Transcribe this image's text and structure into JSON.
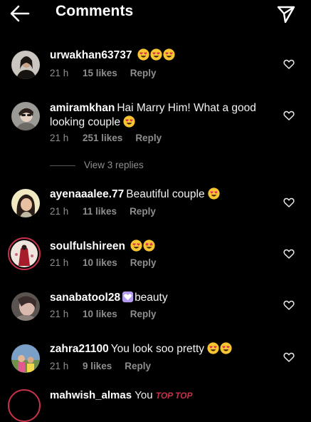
{
  "header": {
    "title": "Comments",
    "back_icon": "arrow-left-icon",
    "share_icon": "paper-plane-icon"
  },
  "comments": [
    {
      "username": "urwakhan63737",
      "text": "",
      "emojis": [
        "heart-eyes",
        "heart-eyes",
        "heart-eyes"
      ],
      "time": "21 h",
      "likes": "15 likes",
      "reply": "Reply"
    },
    {
      "username": "amiramkhan",
      "text": "Hai Marry Him! What a good looking couple",
      "emojis": [
        "heart-eyes"
      ],
      "time": "21 h",
      "likes": "251 likes",
      "reply": "Reply",
      "view_replies": "View 3 replies"
    },
    {
      "username": "ayenaaalee.77",
      "text": "Beautiful couple",
      "emojis": [
        "heart-eyes"
      ],
      "time": "21 h",
      "likes": "11 likes",
      "reply": "Reply"
    },
    {
      "username": "soulfulshireen",
      "text": "",
      "emojis": [
        "heart-eyes",
        "star-struck"
      ],
      "time": "21 h",
      "likes": "10 likes",
      "reply": "Reply"
    },
    {
      "username": "sanabatool28",
      "text": "beauty",
      "emojis": [
        "heart-box"
      ],
      "time": "21 h",
      "likes": "10 likes",
      "reply": "Reply"
    },
    {
      "username": "zahra21100",
      "text": "You look soo pretty",
      "emojis": [
        "heart-eyes",
        "heart-eyes"
      ],
      "time": "21 h",
      "likes": "9 likes",
      "reply": "Reply"
    }
  ],
  "partial_comment": {
    "username": "mahwish_almas",
    "text": "You",
    "tag": "TOP TOP"
  },
  "colors": {
    "background": "#000000",
    "secondary_text": "#8e8e8e",
    "emoji_yellow": "#f7c531",
    "heart_red": "#e0245e",
    "story_ring": "#c4324a"
  }
}
